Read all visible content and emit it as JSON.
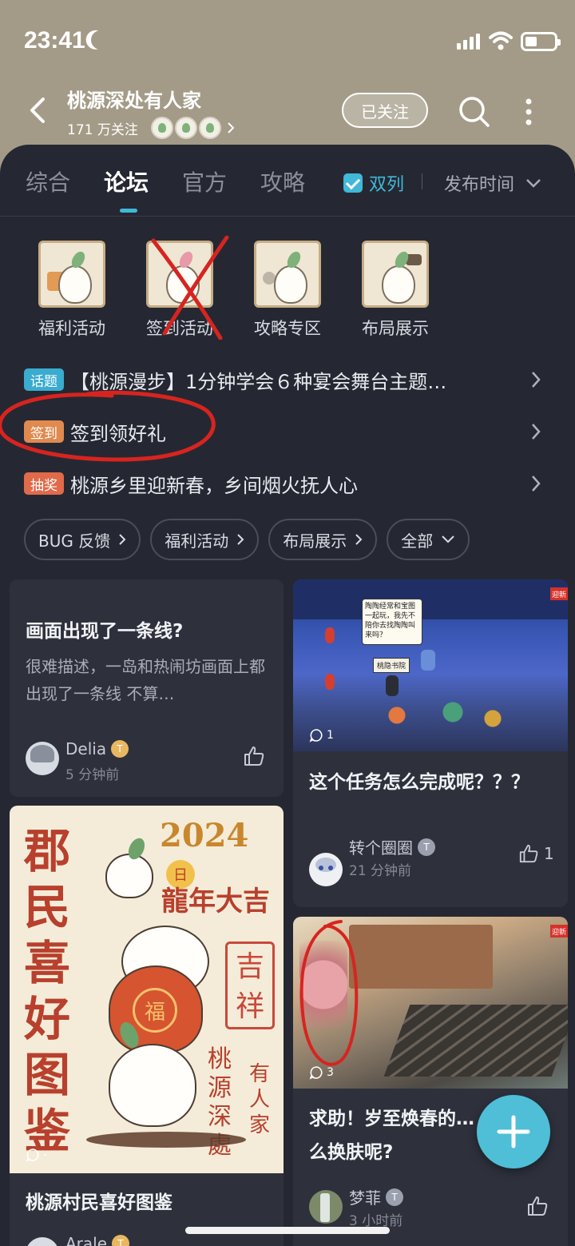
{
  "status": {
    "time": "23:41"
  },
  "header": {
    "title": "桃源深处有人家",
    "followers": "171 万关注",
    "follow_label": "已关注"
  },
  "tabs": [
    {
      "label": "综合"
    },
    {
      "label": "论坛"
    },
    {
      "label": "官方"
    },
    {
      "label": "攻略"
    }
  ],
  "view_toggle": "双列",
  "sort_label": "发布时间",
  "categories": [
    {
      "label": "福利活动"
    },
    {
      "label": "签到活动"
    },
    {
      "label": "攻略专区"
    },
    {
      "label": "布局展示"
    }
  ],
  "notices": [
    {
      "tag": "话题",
      "tag_color": "#3aaccf",
      "text": "【桃源漫步】1分钟学会６种宴会舞台主题…"
    },
    {
      "tag": "签到",
      "tag_color": "#e08a4f",
      "text": "签到领好礼"
    },
    {
      "tag": "抽奖",
      "tag_color": "#e06a4a",
      "text": "桃源乡里迎新春，乡间烟火抚人心"
    }
  ],
  "chips": [
    {
      "label": "BUG 反馈"
    },
    {
      "label": "福利活动"
    },
    {
      "label": "布局展示"
    },
    {
      "label": "全部"
    }
  ],
  "posts": {
    "p1": {
      "title": "画面出现了一条线?",
      "body": "很难描述，一岛和热闹坊画面上都出现了一条线 不算…",
      "user": "Delia",
      "time": "5 分钟前"
    },
    "p2": {
      "comments": "1",
      "title": "这个任务怎么完成呢？？？",
      "user": "转个圈圈",
      "time": "21 分钟前",
      "likes": "1",
      "image_texts": {
        "bubble": "陶陶经常和宝图一起玩，我先不陪你去找陶陶叫来吗？",
        "sign": "桃隐书院",
        "corner": "迎新"
      }
    },
    "p3": {
      "comments": "-",
      "title": "桃源村民喜好图鉴",
      "user": "Arale",
      "image_texts": {
        "big": "郡民喜好图鉴",
        "year": "2024",
        "dragon": "龍年大吉",
        "blessing": "吉祥",
        "vertical1": "桃源深處",
        "vertical2": "有人家",
        "fu": "福",
        "day": "日"
      }
    },
    "p4": {
      "comments": "3",
      "title": "求助！岁至焕春的…么换肤呢?",
      "user": "梦菲",
      "time": "3 小时前",
      "image_texts": {
        "corner": "迎新"
      }
    }
  }
}
